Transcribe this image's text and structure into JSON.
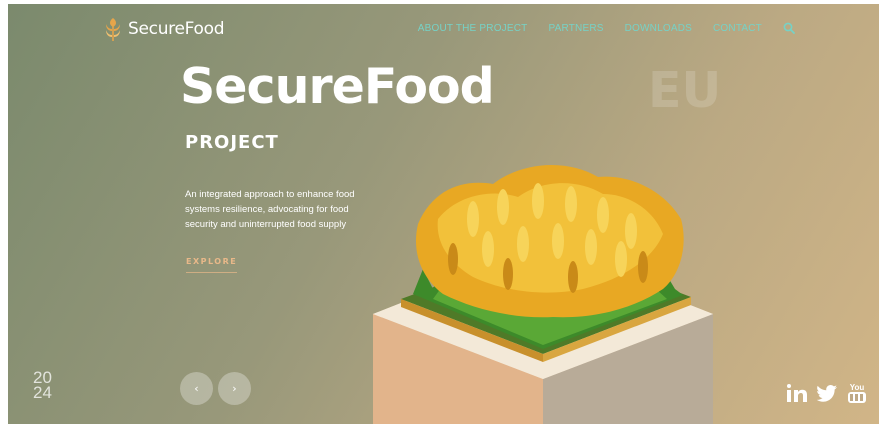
{
  "brand": {
    "name": "SecureFood"
  },
  "nav": {
    "items": [
      {
        "label": "ABOUT THE PROJECT"
      },
      {
        "label": "PARTNERS"
      },
      {
        "label": "DOWNLOADS"
      },
      {
        "label": "CONTACT"
      }
    ],
    "search_icon": "search-icon"
  },
  "hero": {
    "title": "SecureFood",
    "watermark": "EU",
    "subtitle": "PROJECT",
    "description": "An integrated approach to enhance food systems resilience, advocating for food security and uninterrupted food supply",
    "cta": "EXPLORE"
  },
  "year": {
    "top": "20",
    "bottom": "24"
  },
  "carousel": {
    "prev_icon": "chevron-left-icon",
    "next_icon": "chevron-right-icon",
    "prev_glyph": "‹",
    "next_glyph": "›"
  },
  "social": [
    {
      "icon": "linkedin-icon"
    },
    {
      "icon": "twitter-icon"
    },
    {
      "icon": "youtube-icon",
      "text": "You"
    }
  ],
  "colors": {
    "nav_accent": "#76d2c6",
    "cta_accent": "#e8b889",
    "background_start": "#7b8a6d",
    "background_end": "#d1b587"
  }
}
